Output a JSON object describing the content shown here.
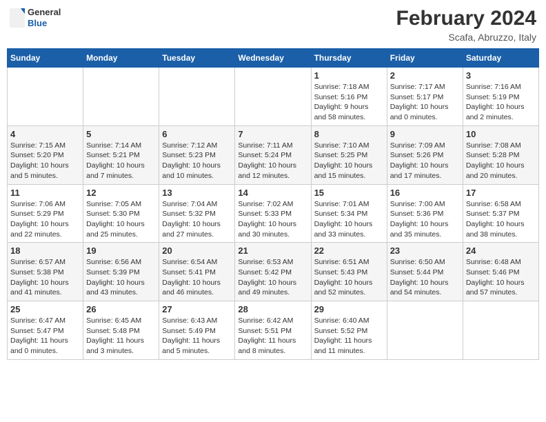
{
  "header": {
    "logo_line1": "General",
    "logo_line2": "Blue",
    "title": "February 2024",
    "subtitle": "Scafa, Abruzzo, Italy"
  },
  "columns": [
    "Sunday",
    "Monday",
    "Tuesday",
    "Wednesday",
    "Thursday",
    "Friday",
    "Saturday"
  ],
  "weeks": [
    [
      {
        "day": "",
        "info": ""
      },
      {
        "day": "",
        "info": ""
      },
      {
        "day": "",
        "info": ""
      },
      {
        "day": "",
        "info": ""
      },
      {
        "day": "1",
        "info": "Sunrise: 7:18 AM\nSunset: 5:16 PM\nDaylight: 9 hours\nand 58 minutes."
      },
      {
        "day": "2",
        "info": "Sunrise: 7:17 AM\nSunset: 5:17 PM\nDaylight: 10 hours\nand 0 minutes."
      },
      {
        "day": "3",
        "info": "Sunrise: 7:16 AM\nSunset: 5:19 PM\nDaylight: 10 hours\nand 2 minutes."
      }
    ],
    [
      {
        "day": "4",
        "info": "Sunrise: 7:15 AM\nSunset: 5:20 PM\nDaylight: 10 hours\nand 5 minutes."
      },
      {
        "day": "5",
        "info": "Sunrise: 7:14 AM\nSunset: 5:21 PM\nDaylight: 10 hours\nand 7 minutes."
      },
      {
        "day": "6",
        "info": "Sunrise: 7:12 AM\nSunset: 5:23 PM\nDaylight: 10 hours\nand 10 minutes."
      },
      {
        "day": "7",
        "info": "Sunrise: 7:11 AM\nSunset: 5:24 PM\nDaylight: 10 hours\nand 12 minutes."
      },
      {
        "day": "8",
        "info": "Sunrise: 7:10 AM\nSunset: 5:25 PM\nDaylight: 10 hours\nand 15 minutes."
      },
      {
        "day": "9",
        "info": "Sunrise: 7:09 AM\nSunset: 5:26 PM\nDaylight: 10 hours\nand 17 minutes."
      },
      {
        "day": "10",
        "info": "Sunrise: 7:08 AM\nSunset: 5:28 PM\nDaylight: 10 hours\nand 20 minutes."
      }
    ],
    [
      {
        "day": "11",
        "info": "Sunrise: 7:06 AM\nSunset: 5:29 PM\nDaylight: 10 hours\nand 22 minutes."
      },
      {
        "day": "12",
        "info": "Sunrise: 7:05 AM\nSunset: 5:30 PM\nDaylight: 10 hours\nand 25 minutes."
      },
      {
        "day": "13",
        "info": "Sunrise: 7:04 AM\nSunset: 5:32 PM\nDaylight: 10 hours\nand 27 minutes."
      },
      {
        "day": "14",
        "info": "Sunrise: 7:02 AM\nSunset: 5:33 PM\nDaylight: 10 hours\nand 30 minutes."
      },
      {
        "day": "15",
        "info": "Sunrise: 7:01 AM\nSunset: 5:34 PM\nDaylight: 10 hours\nand 33 minutes."
      },
      {
        "day": "16",
        "info": "Sunrise: 7:00 AM\nSunset: 5:36 PM\nDaylight: 10 hours\nand 35 minutes."
      },
      {
        "day": "17",
        "info": "Sunrise: 6:58 AM\nSunset: 5:37 PM\nDaylight: 10 hours\nand 38 minutes."
      }
    ],
    [
      {
        "day": "18",
        "info": "Sunrise: 6:57 AM\nSunset: 5:38 PM\nDaylight: 10 hours\nand 41 minutes."
      },
      {
        "day": "19",
        "info": "Sunrise: 6:56 AM\nSunset: 5:39 PM\nDaylight: 10 hours\nand 43 minutes."
      },
      {
        "day": "20",
        "info": "Sunrise: 6:54 AM\nSunset: 5:41 PM\nDaylight: 10 hours\nand 46 minutes."
      },
      {
        "day": "21",
        "info": "Sunrise: 6:53 AM\nSunset: 5:42 PM\nDaylight: 10 hours\nand 49 minutes."
      },
      {
        "day": "22",
        "info": "Sunrise: 6:51 AM\nSunset: 5:43 PM\nDaylight: 10 hours\nand 52 minutes."
      },
      {
        "day": "23",
        "info": "Sunrise: 6:50 AM\nSunset: 5:44 PM\nDaylight: 10 hours\nand 54 minutes."
      },
      {
        "day": "24",
        "info": "Sunrise: 6:48 AM\nSunset: 5:46 PM\nDaylight: 10 hours\nand 57 minutes."
      }
    ],
    [
      {
        "day": "25",
        "info": "Sunrise: 6:47 AM\nSunset: 5:47 PM\nDaylight: 11 hours\nand 0 minutes."
      },
      {
        "day": "26",
        "info": "Sunrise: 6:45 AM\nSunset: 5:48 PM\nDaylight: 11 hours\nand 3 minutes."
      },
      {
        "day": "27",
        "info": "Sunrise: 6:43 AM\nSunset: 5:49 PM\nDaylight: 11 hours\nand 5 minutes."
      },
      {
        "day": "28",
        "info": "Sunrise: 6:42 AM\nSunset: 5:51 PM\nDaylight: 11 hours\nand 8 minutes."
      },
      {
        "day": "29",
        "info": "Sunrise: 6:40 AM\nSunset: 5:52 PM\nDaylight: 11 hours\nand 11 minutes."
      },
      {
        "day": "",
        "info": ""
      },
      {
        "day": "",
        "info": ""
      }
    ]
  ]
}
